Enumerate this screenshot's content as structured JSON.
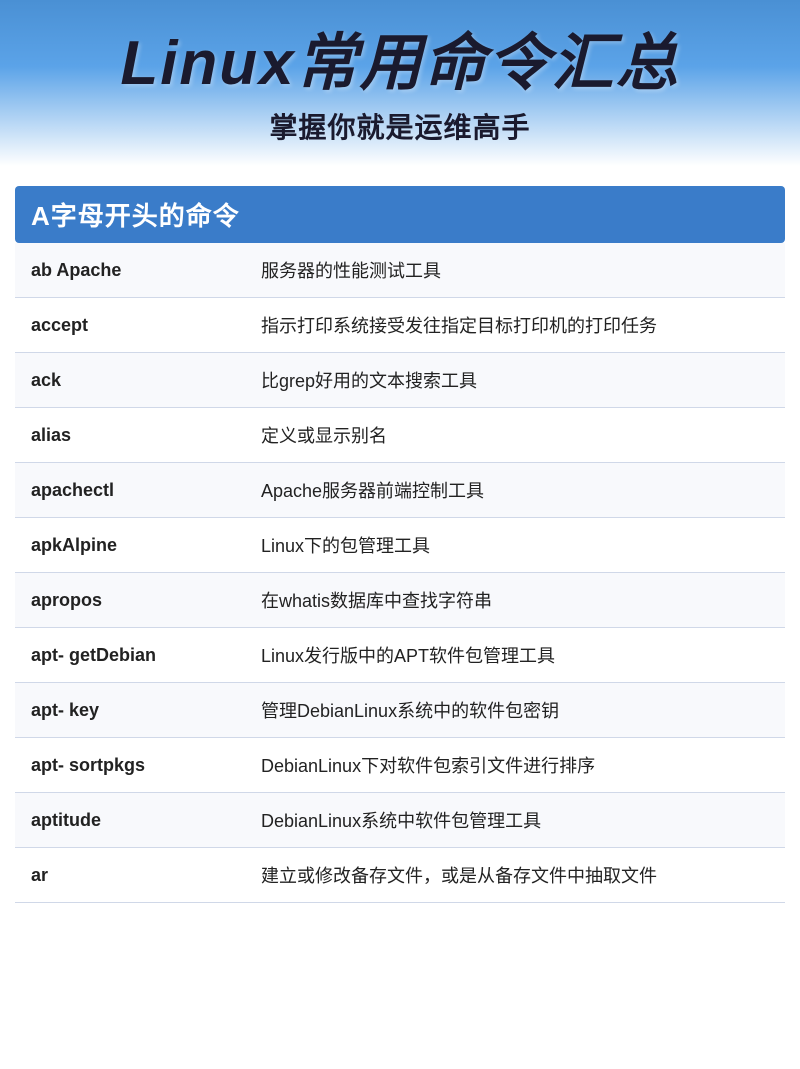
{
  "header": {
    "main_title": "Linux常用命令汇总",
    "subtitle": "掌握你就是运维高手"
  },
  "section": {
    "label": "A字母开头的命令"
  },
  "commands": [
    {
      "name": "ab  Apache",
      "desc": "服务器的性能测试工具"
    },
    {
      "name": "accept",
      "desc": "指示打印系统接受发往指定目标打印机的打印任务"
    },
    {
      "name": "ack",
      "desc": "比grep好用的文本搜索工具"
    },
    {
      "name": "alias",
      "desc": "定义或显示别名"
    },
    {
      "name": "apachectl",
      "desc": "Apache服务器前端控制工具"
    },
    {
      "name": "apkAlpine",
      "desc": "Linux下的包管理工具"
    },
    {
      "name": "apropos",
      "desc": "在whatis数据库中查找字符串"
    },
    {
      "name": "apt-  getDebian",
      "desc": "Linux发行版中的APT软件包管理工具"
    },
    {
      "name": "apt-  key",
      "desc": "管理DebianLinux系统中的软件包密钥"
    },
    {
      "name": "apt-  sortpkgs",
      "desc": "DebianLinux下对软件包索引文件进行排序"
    },
    {
      "name": "aptitude",
      "desc": "DebianLinux系统中软件包管理工具"
    },
    {
      "name": "ar",
      "desc": "建立或修改备存文件，或是从备存文件中抽取文件"
    }
  ]
}
